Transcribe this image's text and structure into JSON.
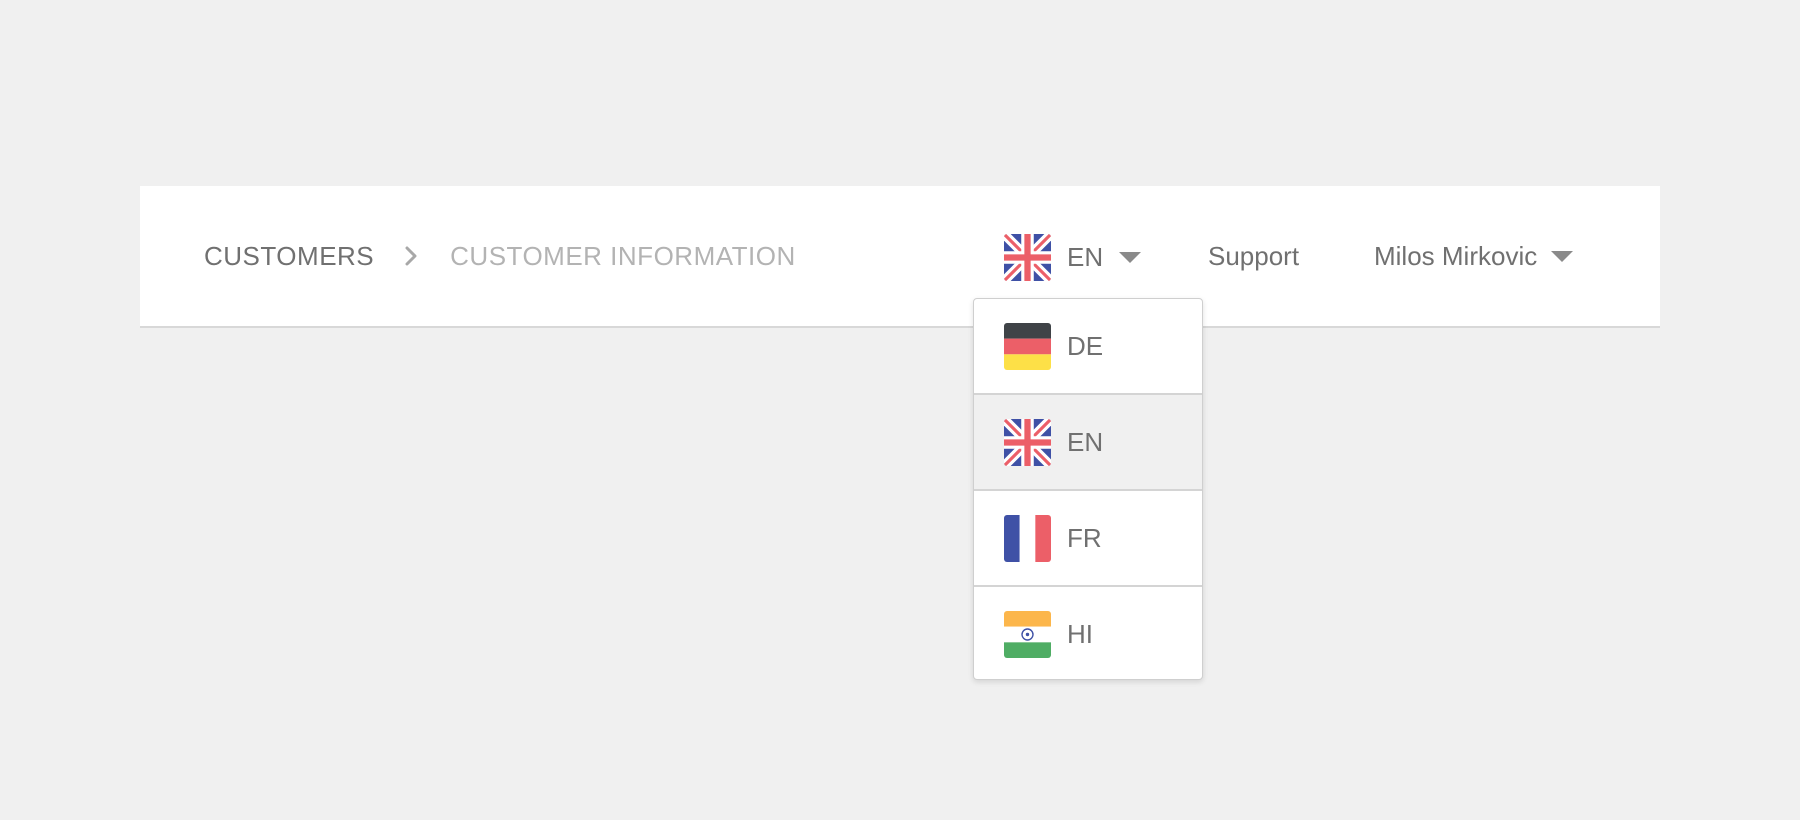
{
  "breadcrumb": {
    "items": [
      "CUSTOMERS",
      "CUSTOMER INFORMATION"
    ],
    "separator_icon": "chevron-right-icon"
  },
  "language": {
    "current": "EN",
    "current_flag": "uk-flag-icon",
    "caret_icon": "caret-down-icon",
    "options": [
      {
        "code": "DE",
        "flag": "germany-flag-icon",
        "selected": false
      },
      {
        "code": "EN",
        "flag": "uk-flag-icon",
        "selected": true
      },
      {
        "code": "FR",
        "flag": "france-flag-icon",
        "selected": false
      },
      {
        "code": "HI",
        "flag": "india-flag-icon",
        "selected": false
      }
    ]
  },
  "nav": {
    "support_label": "Support",
    "user_name": "Milos Mirkovic",
    "user_caret_icon": "caret-down-icon"
  },
  "colors": {
    "background": "#f0f0f0",
    "bar": "#ffffff",
    "text": "#707070",
    "text_muted": "#b3b3b3",
    "selected_row": "#f0f0f0",
    "flag_blue": "#3f51a6",
    "flag_red": "#ec5f68",
    "de_black": "#3f4347",
    "de_yellow": "#fde047",
    "in_saffron": "#fcb64b",
    "in_green": "#4fad64"
  }
}
